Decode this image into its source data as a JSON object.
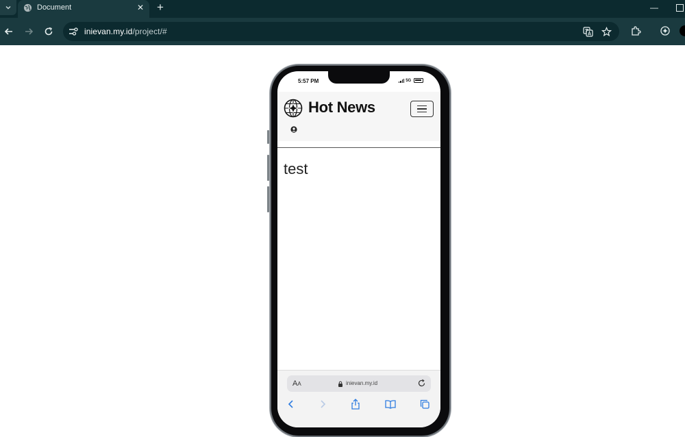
{
  "browser": {
    "tab": {
      "title": "Document",
      "close_glyph": "✕"
    },
    "new_tab_glyph": "+",
    "minimize_glyph": "—",
    "address": {
      "host": "inievan.my.id",
      "path": "/project/#"
    },
    "icons": [
      "tab-list-icon",
      "globe-icon",
      "back-arrow-icon",
      "forward-arrow-icon",
      "reload-icon",
      "site-info-icon",
      "translate-icon",
      "star-icon",
      "extensions-icon",
      "gemini-icon"
    ]
  },
  "phone": {
    "status": {
      "time": "5:57 PM",
      "network": "5G"
    },
    "site": {
      "brand": "Hot News",
      "content": "test"
    },
    "safari": {
      "text_size_large": "A",
      "text_size_small": "A",
      "domain": "inievan.my.id"
    }
  },
  "colors": {
    "chrome_dark": "#0c2a2f",
    "chrome_toolbar": "#1a3a3f",
    "page_bg": "#ffffff",
    "site_header_bg": "#f6f6f6",
    "safari_blue": "#2f7de1"
  }
}
